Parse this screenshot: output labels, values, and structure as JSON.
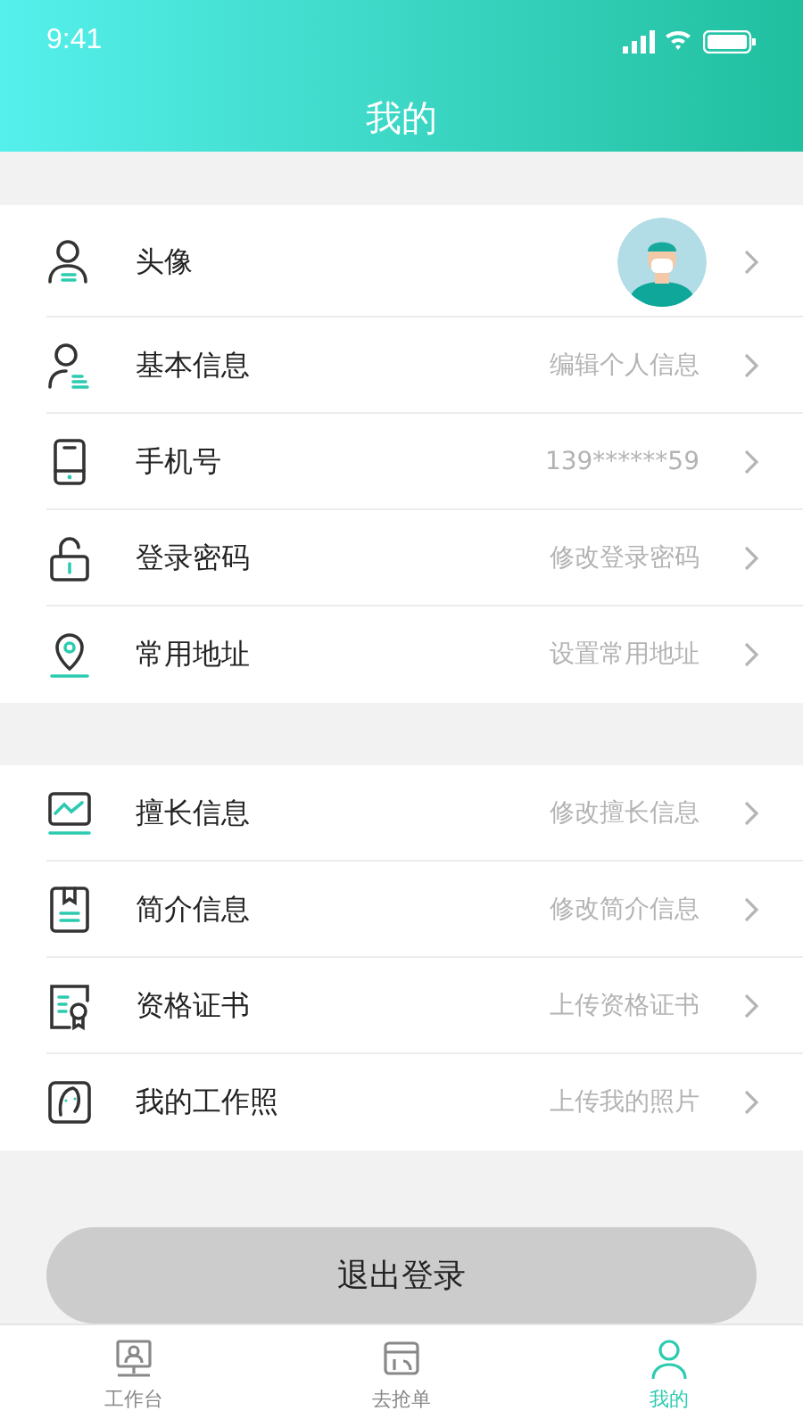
{
  "status_bar": {
    "time": "9:41"
  },
  "header": {
    "title": "我的"
  },
  "sections": [
    {
      "items": [
        {
          "kind": "avatar",
          "label": "头像"
        },
        {
          "kind": "text",
          "label": "基本信息",
          "value": "编辑个人信息"
        },
        {
          "kind": "text",
          "label": "手机号",
          "value": "139******59"
        },
        {
          "kind": "text",
          "label": "登录密码",
          "value": "修改登录密码"
        },
        {
          "kind": "text",
          "label": "常用地址",
          "value": "设置常用地址"
        }
      ]
    },
    {
      "items": [
        {
          "kind": "text",
          "label": "擅长信息",
          "value": "修改擅长信息"
        },
        {
          "kind": "text",
          "label": "简介信息",
          "value": "修改简介信息"
        },
        {
          "kind": "text",
          "label": "资格证书",
          "value": "上传资格证书"
        },
        {
          "kind": "text",
          "label": "我的工作照",
          "value": "上传我的照片"
        }
      ]
    }
  ],
  "logout_button": "退出登录",
  "tab_bar": [
    {
      "label": "工作台",
      "selected": false
    },
    {
      "label": "去抢单",
      "selected": false
    },
    {
      "label": "我的",
      "selected": true
    }
  ]
}
